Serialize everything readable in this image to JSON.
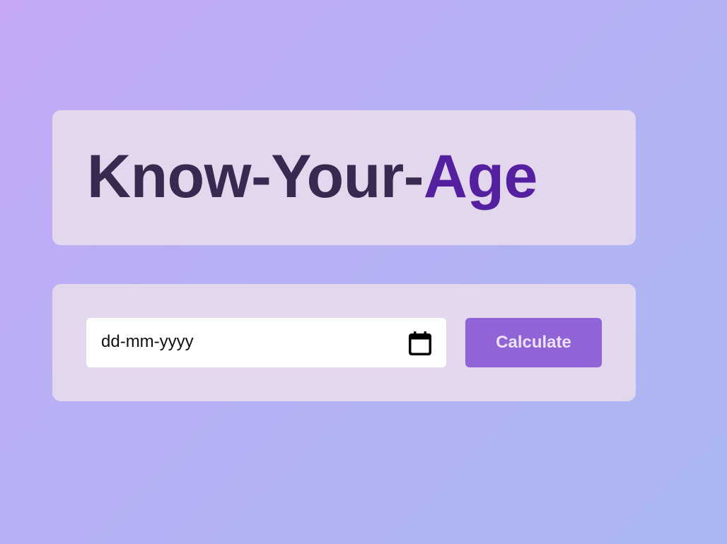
{
  "header": {
    "title_main": "Know-Your-",
    "title_accent": "Age"
  },
  "form": {
    "date_placeholder": "dd-mm-yyyy",
    "calendar_icon": "calendar-icon",
    "calculate_label": "Calculate"
  },
  "colors": {
    "title_text": "#39284f",
    "title_accent": "#5520a0",
    "card_background": "#e3d7ee",
    "button_background": "#9063d6",
    "button_text": "#ece3fb"
  }
}
